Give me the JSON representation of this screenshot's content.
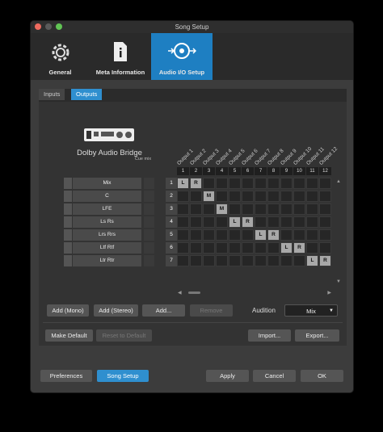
{
  "window": {
    "title": "Song Setup"
  },
  "toolbar": {
    "items": [
      {
        "label": "General",
        "icon": "gear-icon"
      },
      {
        "label": "Meta Information",
        "icon": "info-document-icon"
      },
      {
        "label": "Audio I/O Setup",
        "icon": "audio-io-icon",
        "active": true
      }
    ]
  },
  "tabs": [
    {
      "label": "Inputs"
    },
    {
      "label": "Outputs",
      "active": true
    }
  ],
  "device": {
    "name": "Dolby Audio Bridge",
    "icon": "audio-interface-icon"
  },
  "cue_mix_header": "Cue mix",
  "outputs": [
    "Output 1",
    "Output 2",
    "Output 3",
    "Output 4",
    "Output 5",
    "Output 6",
    "Output 7",
    "Output 8",
    "Output 9",
    "Output 10",
    "Output 11",
    "Output 12"
  ],
  "columns": [
    "1",
    "2",
    "3",
    "4",
    "5",
    "6",
    "7",
    "8",
    "9",
    "10",
    "11",
    "12"
  ],
  "rows": [
    {
      "name": "Mix",
      "num": "1",
      "assign": [
        {
          "col": 0,
          "label": "L"
        },
        {
          "col": 1,
          "label": "R"
        }
      ]
    },
    {
      "name": "C",
      "num": "2",
      "assign": [
        {
          "col": 2,
          "label": "M"
        }
      ]
    },
    {
      "name": "LFE",
      "num": "3",
      "assign": [
        {
          "col": 3,
          "label": "M"
        }
      ]
    },
    {
      "name": "Ls Rs",
      "num": "4",
      "assign": [
        {
          "col": 4,
          "label": "L"
        },
        {
          "col": 5,
          "label": "R"
        }
      ]
    },
    {
      "name": "Lrs Rrs",
      "num": "5",
      "assign": [
        {
          "col": 6,
          "label": "L"
        },
        {
          "col": 7,
          "label": "R"
        }
      ]
    },
    {
      "name": "Ltf Rtf",
      "num": "6",
      "assign": [
        {
          "col": 8,
          "label": "L"
        },
        {
          "col": 9,
          "label": "R"
        }
      ]
    },
    {
      "name": "Ltr Rtr",
      "num": "7",
      "assign": [
        {
          "col": 10,
          "label": "L"
        },
        {
          "col": 11,
          "label": "R"
        }
      ]
    }
  ],
  "buttons": {
    "add_mono": "Add (Mono)",
    "add_stereo": "Add (Stereo)",
    "add": "Add...",
    "remove": "Remove",
    "audition_label": "Audition",
    "audition_value": "Mix",
    "make_default": "Make Default",
    "reset_default": "Reset to Default",
    "import": "Import...",
    "export": "Export...",
    "preferences": "Preferences",
    "song_setup": "Song Setup",
    "apply": "Apply",
    "cancel": "Cancel",
    "ok": "OK"
  },
  "colors": {
    "accent": "#2f8fcf",
    "cell_on": "#a8a8a8"
  }
}
